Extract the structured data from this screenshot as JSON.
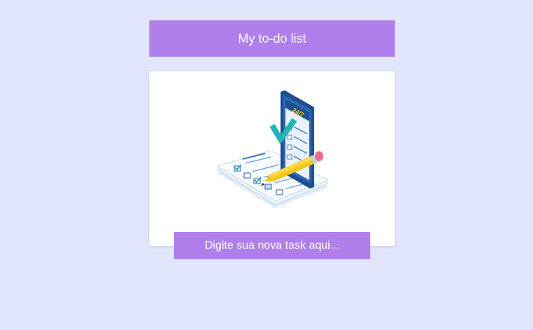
{
  "header": {
    "title": "My to-do list"
  },
  "illustration": {
    "icon": "checklist-phone-pencil-icon",
    "phone_label": "24/7"
  },
  "task_input": {
    "placeholder": "Digite sua nova task aqui...",
    "value": ""
  },
  "colors": {
    "background": "#e2e6fd",
    "accent": "#b07fec",
    "card": "#ffffff"
  }
}
